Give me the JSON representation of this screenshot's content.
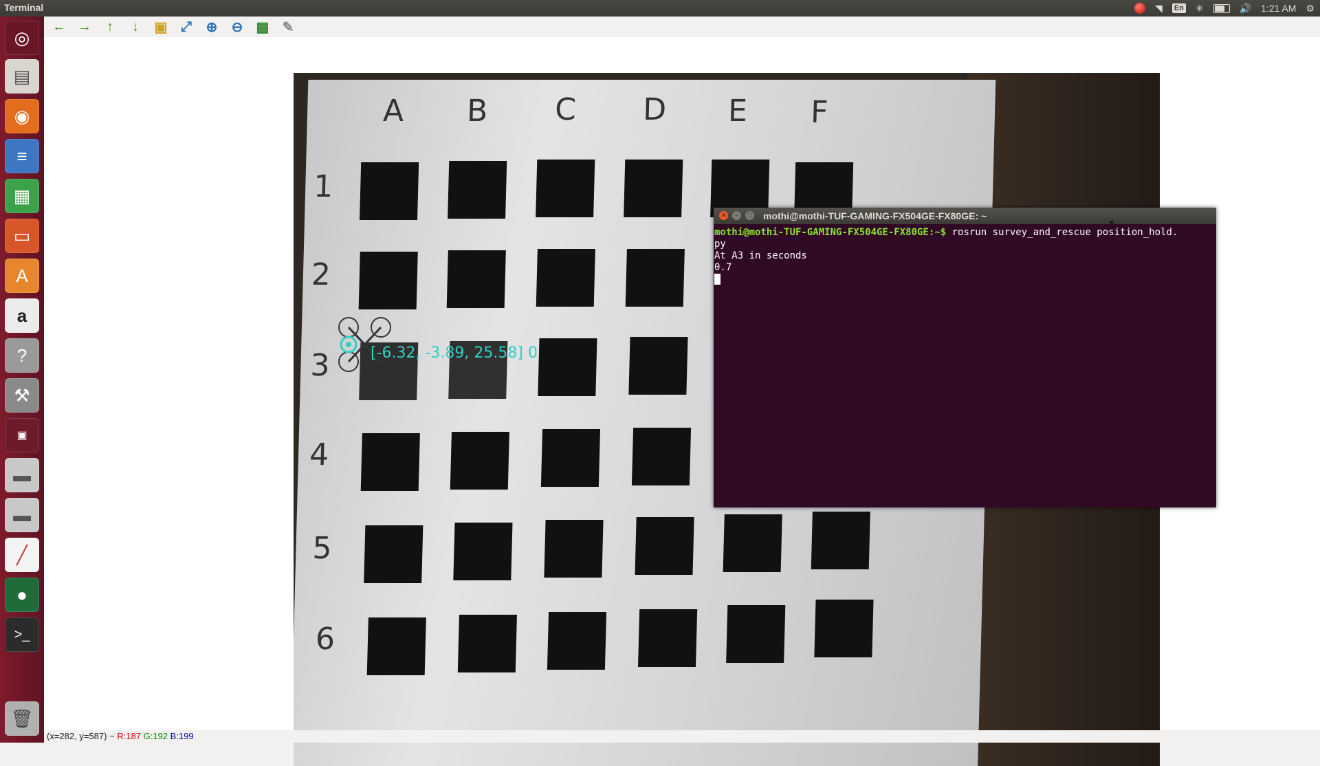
{
  "topbar": {
    "title": "Terminal",
    "clock": "1:21 AM",
    "lang": "En"
  },
  "launcher": {
    "items": [
      "ubuntu-dash-icon",
      "files-icon",
      "firefox-icon",
      "writer-icon",
      "calc-icon",
      "impress-icon",
      "software-center-icon",
      "amazon-icon",
      "help-icon",
      "system-settings-icon",
      "workspace-icon",
      "drive-icon",
      "drive-icon",
      "plot-icon",
      "globe-icon",
      "terminal-icon",
      "trash-icon"
    ]
  },
  "toolbar": {
    "tools": [
      "back-arrow-icon",
      "forward-arrow-icon",
      "up-arrow-icon",
      "down-arrow-icon",
      "image-icon",
      "zoom-fit-icon",
      "zoom-in-icon",
      "zoom-out-icon",
      "save-icon",
      "brush-icon"
    ]
  },
  "board": {
    "columns": [
      "A",
      "B",
      "C",
      "D",
      "E",
      "F"
    ],
    "rows": [
      "1",
      "2",
      "3",
      "4",
      "5",
      "6"
    ],
    "overlay_text": "[-6.32, -3.89, 25.58] 0"
  },
  "status": {
    "coords": "(x=282, y=587) ~",
    "r": "R:187",
    "g": "G:192",
    "b": "B:199"
  },
  "terminal": {
    "title": "mothi@mothi-TUF-GAMING-FX504GE-FX80GE: ~",
    "prompt": "mothi@mothi-TUF-GAMING-FX504GE-FX80GE:~$",
    "command": " rosrun survey_and_rescue position_hold.",
    "command_wrap": "py",
    "line1": "At A3 in seconds",
    "line2": "0.7"
  }
}
